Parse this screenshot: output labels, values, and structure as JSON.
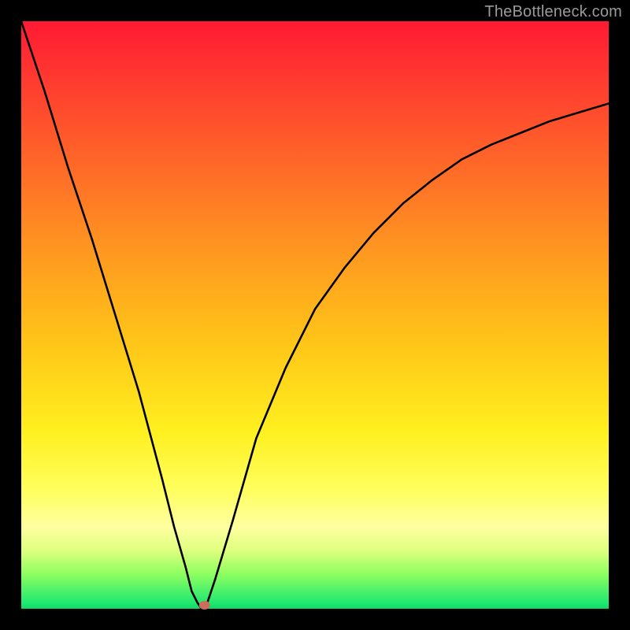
{
  "watermark": "TheBottleneck.com",
  "chart_data": {
    "type": "line",
    "title": "",
    "xlabel": "",
    "ylabel": "",
    "xlim": [
      0,
      100
    ],
    "ylim": [
      0,
      100
    ],
    "series": [
      {
        "name": "bottleneck-curve",
        "x": [
          0,
          4,
          8,
          12,
          16,
          20,
          24,
          26,
          28,
          29,
          30,
          30.7,
          31.5,
          33,
          36,
          40,
          45,
          50,
          55,
          60,
          65,
          70,
          75,
          80,
          85,
          90,
          95,
          100
        ],
        "y": [
          100,
          88,
          75,
          63,
          50,
          37,
          22,
          14,
          7,
          3,
          1,
          0,
          0.5,
          5,
          15,
          29,
          41,
          51,
          58,
          64,
          69,
          73,
          76.5,
          79,
          81,
          83,
          84.5,
          86
        ]
      }
    ],
    "marker": {
      "x": 31.2,
      "y": 0.6,
      "color": "#cc6e5e"
    },
    "colors": {
      "curve": "#000000",
      "frame": "#000000",
      "marker": "#cc6e5e"
    }
  }
}
